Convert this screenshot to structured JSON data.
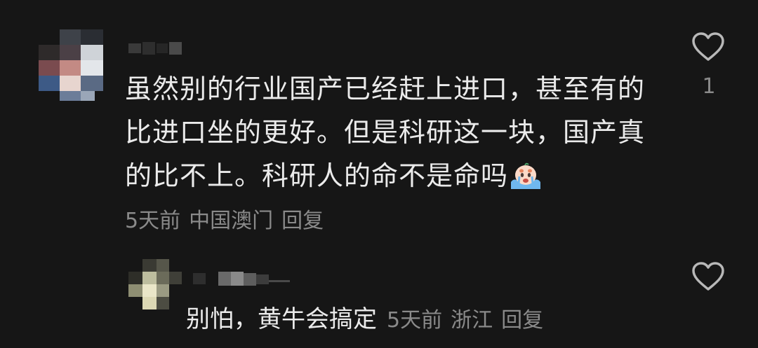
{
  "comment": {
    "text": "虽然别的行业国产已经赶上进口，甚至有的比进口坐的更好。但是科研这一块，国产真的比不上。科研人的命不是命吗",
    "emoji_icon": "crying-face-emoji",
    "time": "5天前",
    "location": "中国澳门",
    "reply_label": "回复",
    "like_count": "1",
    "like_icon": "heart-outline-icon"
  },
  "reply": {
    "text": "别怕，黄牛会搞定",
    "time": "5天前",
    "location": "浙江",
    "reply_label": "回复",
    "like_icon": "heart-outline-icon"
  },
  "colors": {
    "background": "#161616",
    "text_primary": "#ebebeb",
    "text_secondary": "#8a8a8a"
  }
}
